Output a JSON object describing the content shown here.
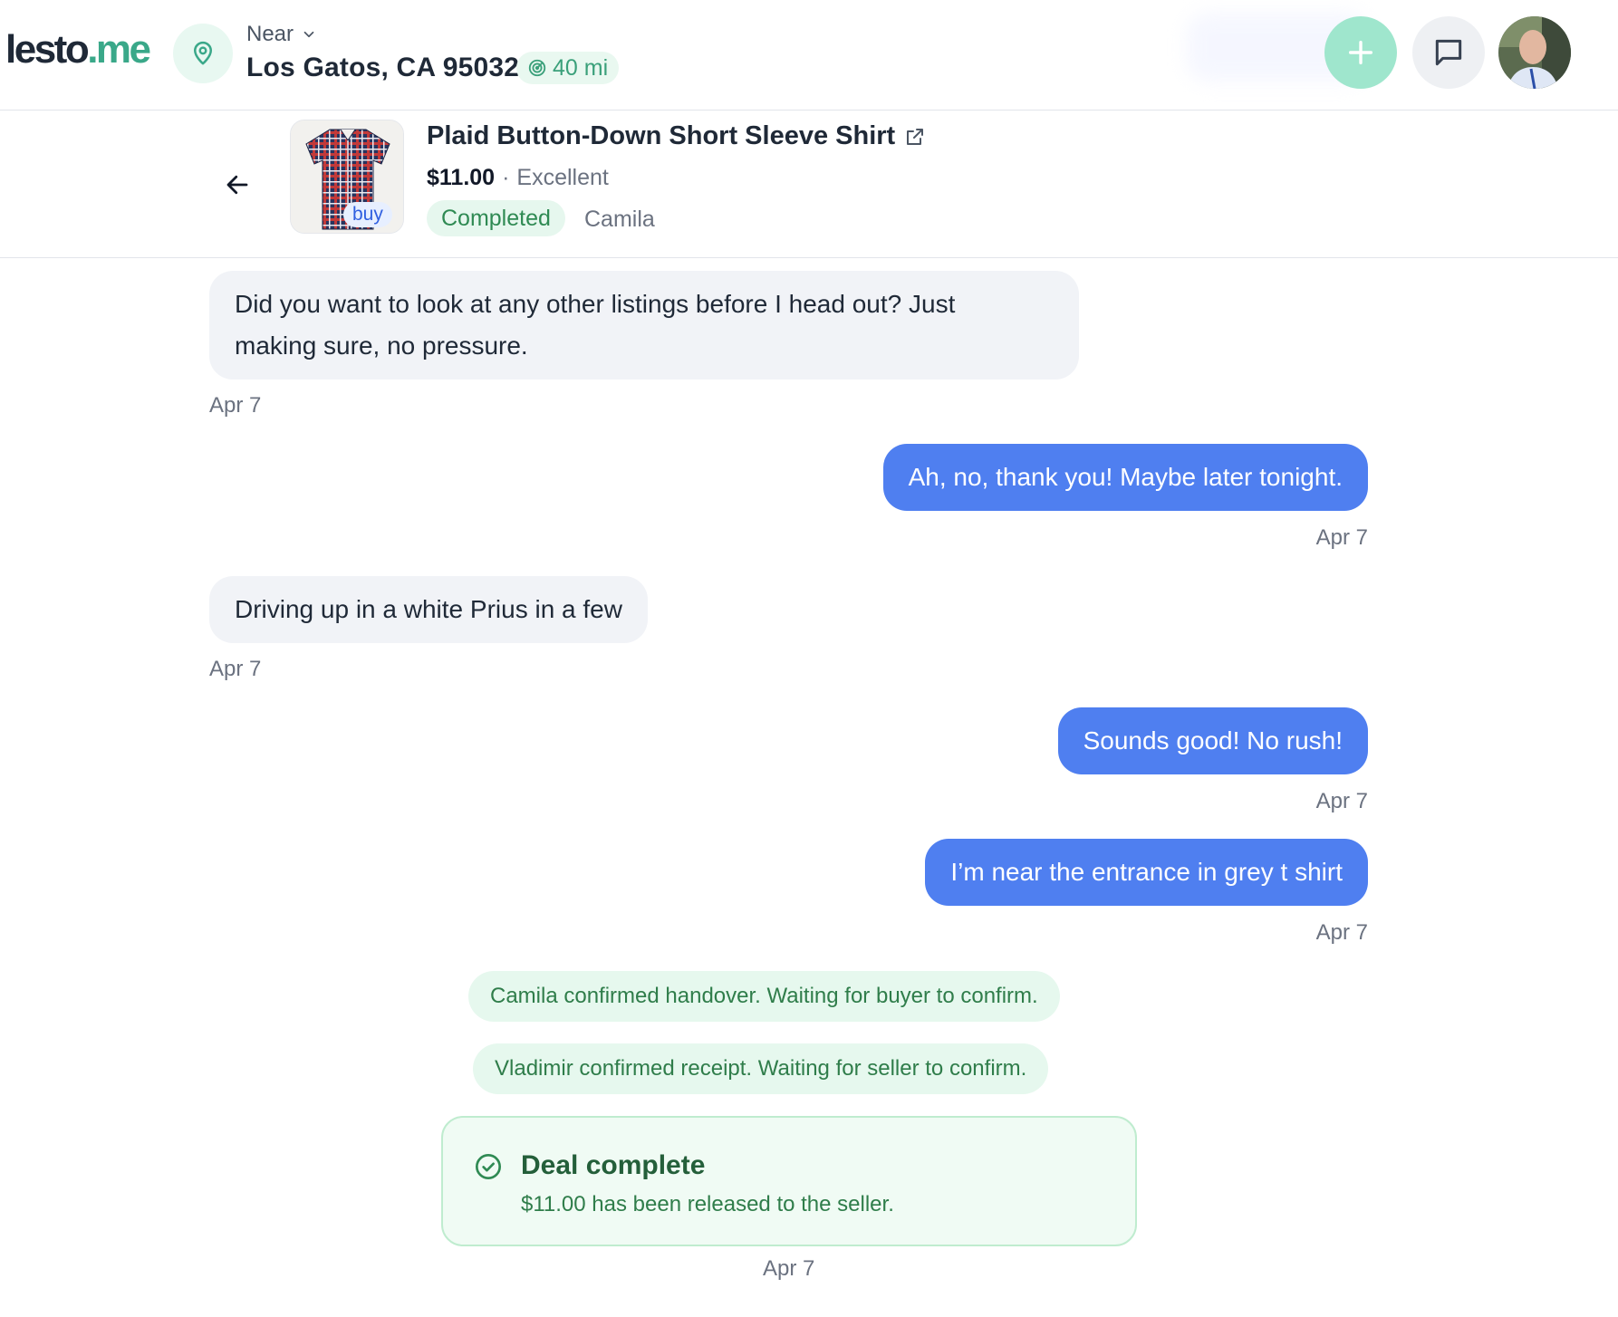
{
  "header": {
    "logo_main": "lesto",
    "logo_accent": ".me",
    "near_label": "Near",
    "location": "Los Gatos, CA 95032",
    "radius": "40 mi",
    "icons": {
      "location": "map-pin-icon",
      "near_dropdown": "chevron-down-icon",
      "radius": "radar-icon",
      "create": "plus-icon",
      "messages": "message-square-icon"
    }
  },
  "listing": {
    "title": "Plaid Button-Down Short Sleeve Shirt",
    "price": "$11.00",
    "separator": "·",
    "condition": "Excellent",
    "status": "Completed",
    "other_party": "Camila",
    "badge": "buy",
    "icons": {
      "back": "arrow-left-icon",
      "external": "external-link-icon"
    }
  },
  "messages": [
    {
      "side": "in",
      "lines": [
        "Did you want to look at any other listings before I head out? Just",
        "making sure, no pressure."
      ],
      "time": "Apr 7"
    },
    {
      "side": "out",
      "lines": [
        "Ah, no, thank you! Maybe later tonight."
      ],
      "time": "Apr 7"
    },
    {
      "side": "in",
      "lines": [
        "Driving up in a white Prius in a few"
      ],
      "time": "Apr 7"
    },
    {
      "side": "out",
      "lines": [
        "Sounds good! No rush!"
      ],
      "time": "Apr 7"
    },
    {
      "side": "out",
      "lines": [
        "I’m near the entrance in grey t shirt"
      ],
      "time": "Apr 7"
    }
  ],
  "system_notes": [
    "Camila confirmed handover. Waiting for buyer to confirm.",
    "Vladimir confirmed receipt. Waiting for seller to confirm."
  ],
  "deal": {
    "title": "Deal complete",
    "subtitle": "$11.00 has been released to the seller.",
    "time": "Apr 7",
    "icon": "check-circle-icon"
  },
  "colors": {
    "brand_green": "#3aa889",
    "outgoing_bubble": "#4f7ff0",
    "incoming_bubble": "#f1f3f7",
    "status_green": "#2f8a53"
  }
}
